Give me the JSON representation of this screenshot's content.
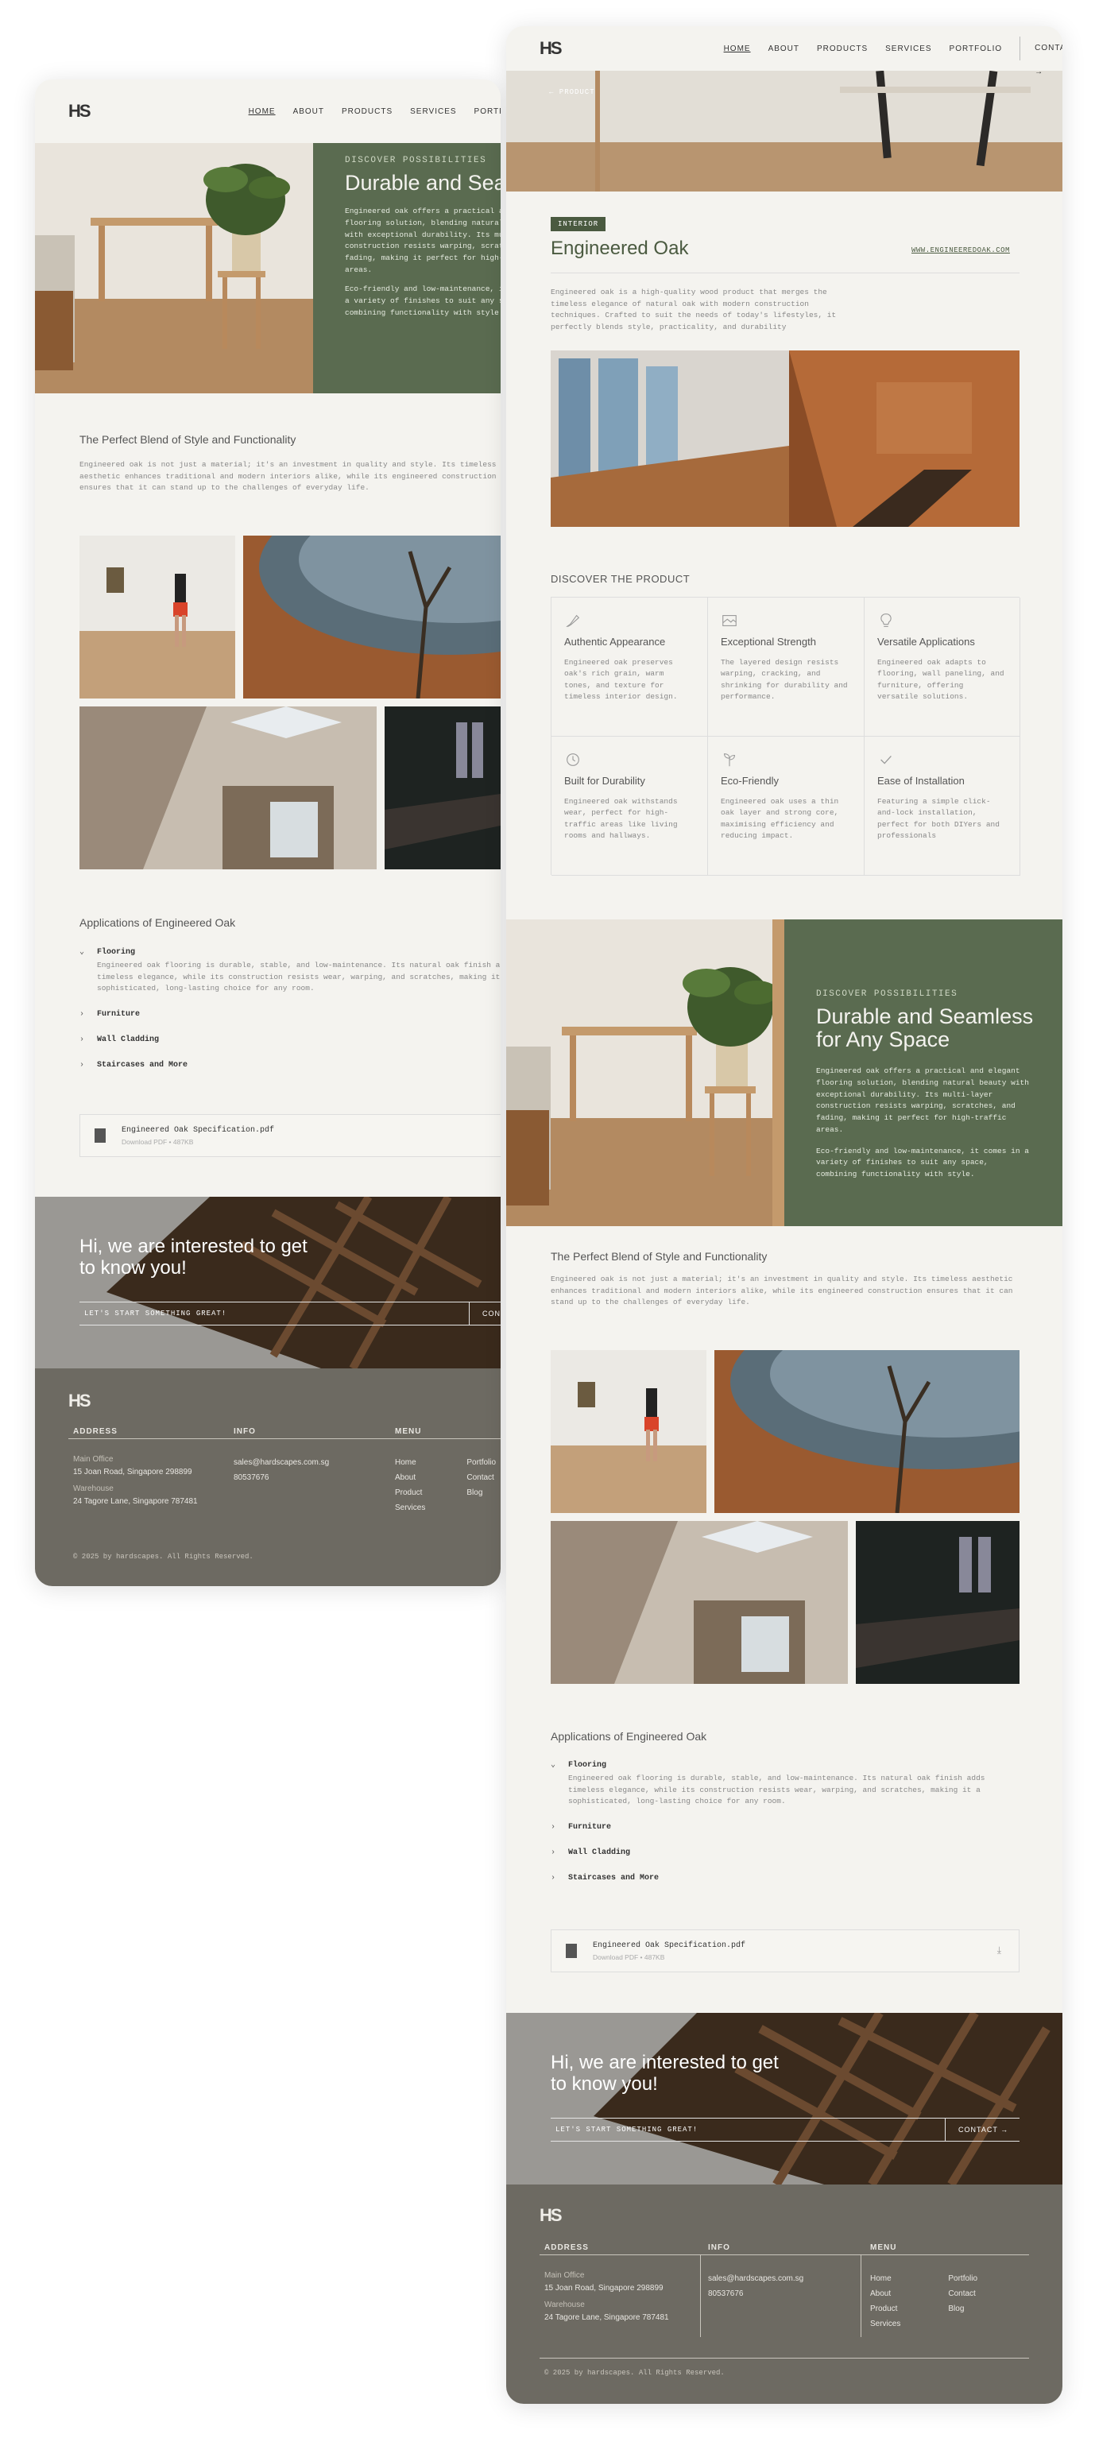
{
  "brand": {
    "logo": "HS"
  },
  "nav": {
    "items": [
      "HOME",
      "ABOUT",
      "PRODUCTS",
      "SERVICES",
      "PORTFOLIO"
    ],
    "contact": "CONTACT →"
  },
  "product": {
    "back": "← PRODUCT",
    "tag": "INTERIOR",
    "title": "Engineered Oak",
    "link": "WWW.ENGINEEREDOAK.COM",
    "intro": "Engineered oak is a high-quality wood product that merges the timeless elegance of natural oak with modern construction techniques. Crafted to suit the needs of today's lifestyles, it perfectly blends style, practicality, and durability"
  },
  "discover_product": {
    "heading": "DISCOVER THE PRODUCT",
    "features": [
      {
        "icon": "brush-icon",
        "title": "Authentic Appearance",
        "desc": "Engineered oak preserves oak's rich grain, warm tones, and texture for timeless interior design."
      },
      {
        "icon": "layers-icon",
        "title": "Exceptional Strength",
        "desc": "The layered design resists warping, cracking, and shrinking for durability and performance."
      },
      {
        "icon": "bulb-icon",
        "title": "Versatile Applications",
        "desc": "Engineered oak adapts to flooring, wall paneling, and furniture, offering versatile solutions."
      },
      {
        "icon": "history-icon",
        "title": "Built for Durability",
        "desc": "Engineered oak withstands wear, perfect for high-traffic areas like living rooms and hallways."
      },
      {
        "icon": "sprout-icon",
        "title": "Eco-Friendly",
        "desc": "Engineered oak uses a thin oak layer and strong core, maximising efficiency and reducing impact."
      },
      {
        "icon": "check-icon",
        "title": "Ease of Installation",
        "desc": "Featuring a simple click-and-lock installation, perfect for both DIYers and professionals"
      }
    ]
  },
  "hero": {
    "kicker": "DISCOVER POSSIBILITIES",
    "title": "Durable and Seamless for Any Space",
    "p1": "Engineered oak offers a practical and elegant flooring solution, blending natural beauty with exceptional durability. Its multi-layer construction resists warping, scratches, and fading, making it perfect for high-traffic areas.",
    "p2": "Eco-friendly and low-maintenance, it comes in a variety of finishes to suit any space, combining functionality with style."
  },
  "blend": {
    "heading": "The Perfect Blend of Style and Functionality",
    "text": "Engineered oak is not just a material; it's an investment in quality and style. Its timeless aesthetic enhances traditional and modern interiors alike, while its engineered construction ensures that it can stand up to the challenges of everyday life."
  },
  "applications": {
    "heading": "Applications of Engineered Oak",
    "items": [
      {
        "label": "Flooring",
        "desc": "Engineered oak flooring is durable, stable, and low-maintenance. Its natural oak finish adds timeless elegance, while its construction resists wear, warping, and scratches, making it a sophisticated, long-lasting choice for any room."
      },
      {
        "label": "Furniture"
      },
      {
        "label": "Wall Cladding"
      },
      {
        "label": "Staircases and More"
      }
    ]
  },
  "pdf": {
    "name": "Engineered Oak Specification.pdf",
    "meta": "Download PDF  •  487KB"
  },
  "cta": {
    "title": "Hi, we are interested to get to know you!",
    "tagline": "LET'S START SOMETHING GREAT!",
    "button": "CONTACT →",
    "button_short": "CON"
  },
  "footer": {
    "address_head": "ADDRESS",
    "office_label": "Main Office",
    "office": "15 Joan Road, Singapore 298899",
    "warehouse_label": "Warehouse",
    "warehouse": "24 Tagore Lane, Singapore 787481",
    "info_head": "INFO",
    "email": "sales@hardscapes.com.sg",
    "phone": "80537676",
    "menu_head": "MENU",
    "menu_col1": [
      "Home",
      "About",
      "Product",
      "Services"
    ],
    "menu_col2": [
      "Portfolio",
      "Contact",
      "Blog"
    ],
    "copyright": "© 2025 by hardscapes. All Rights Reserved."
  },
  "colors": {
    "green": "#5a6b50",
    "footer": "#6d6a62",
    "bg": "#f4f3ef"
  }
}
